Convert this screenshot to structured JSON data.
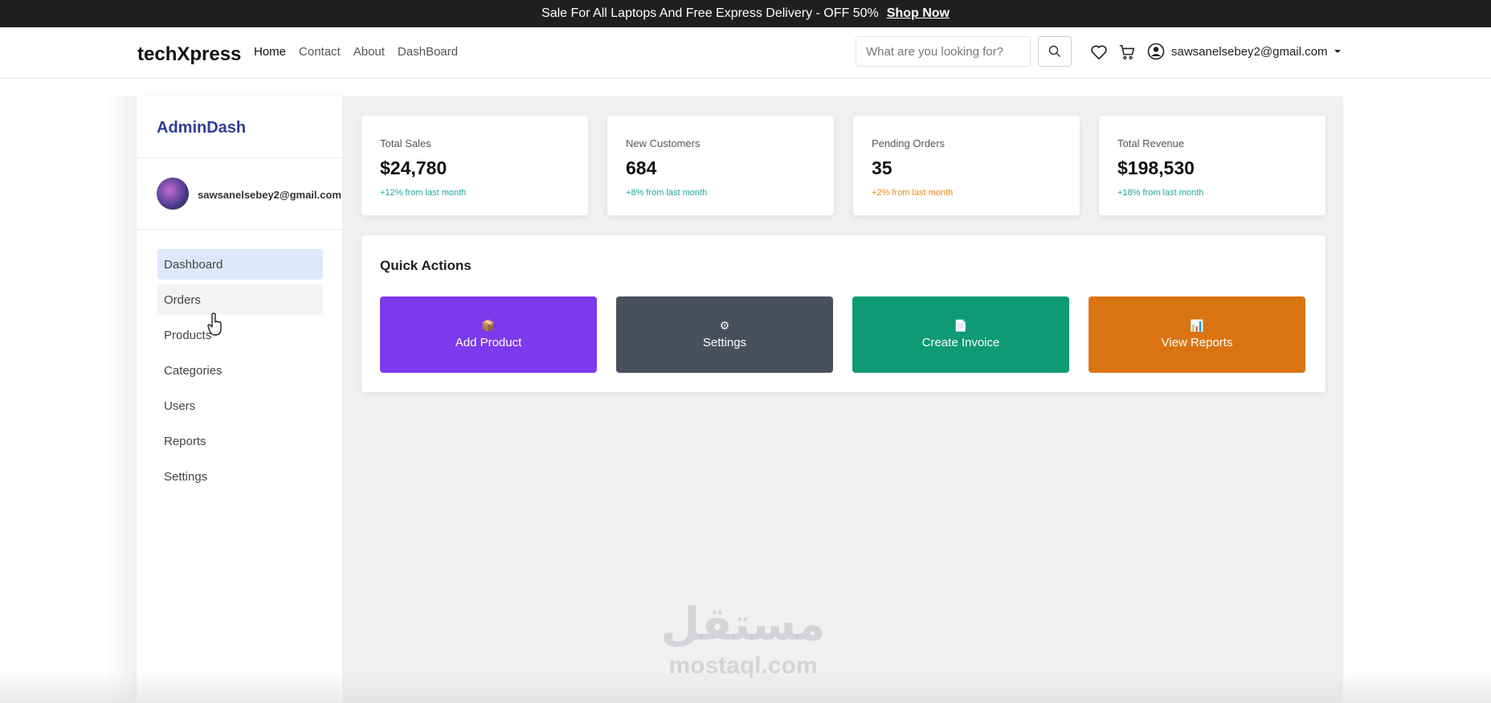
{
  "promo": {
    "text": "Sale For All Laptops And Free Express Delivery - OFF 50%",
    "link": "Shop Now"
  },
  "navbar": {
    "brand": "techXpress",
    "links": [
      {
        "label": "Home",
        "active": true
      },
      {
        "label": "Contact"
      },
      {
        "label": "About"
      },
      {
        "label": "DashBoard"
      }
    ],
    "search_placeholder": "What are you looking for?",
    "user_email": "sawsanelsebey2@gmail.com",
    "icons": [
      "search-icon",
      "heart-icon",
      "cart-icon",
      "user-icon",
      "caret-down-icon"
    ]
  },
  "sidebar": {
    "title": "AdminDash",
    "email": "sawsanelsebey2@gmail.com",
    "items": [
      {
        "label": "Dashboard",
        "active": true
      },
      {
        "label": "Orders"
      },
      {
        "label": "Products"
      },
      {
        "label": "Categories"
      },
      {
        "label": "Users"
      },
      {
        "label": "Reports"
      },
      {
        "label": "Settings"
      }
    ]
  },
  "stats": [
    {
      "label": "Total Sales",
      "value": "$24,780",
      "change": "+12% from last month",
      "color": "#1fa7a2"
    },
    {
      "label": "New Customers",
      "value": "684",
      "change": "+8% from last month",
      "color": "#1fa7a2"
    },
    {
      "label": "Pending Orders",
      "value": "35",
      "change": "+2% from last month",
      "color": "#e8891c"
    },
    {
      "label": "Total Revenue",
      "value": "$198,530",
      "change": "+18% from last month",
      "color": "#1fa7a2"
    }
  ],
  "quick_actions": {
    "title": "Quick Actions",
    "buttons": [
      {
        "label": "Add Product",
        "icon": "box-icon",
        "glyph": "📦",
        "color": "#7c3aed"
      },
      {
        "label": "Settings",
        "icon": "gear-icon",
        "glyph": "⚙",
        "color": "#4a4f5c"
      },
      {
        "label": "Create Invoice",
        "icon": "document-icon",
        "glyph": "📄",
        "color": "#0e9a72"
      },
      {
        "label": "View Reports",
        "icon": "chart-icon",
        "glyph": "📊",
        "color": "#da7412"
      }
    ]
  },
  "watermark": {
    "arabic": "مستقل",
    "latin": "mostaql.com"
  }
}
